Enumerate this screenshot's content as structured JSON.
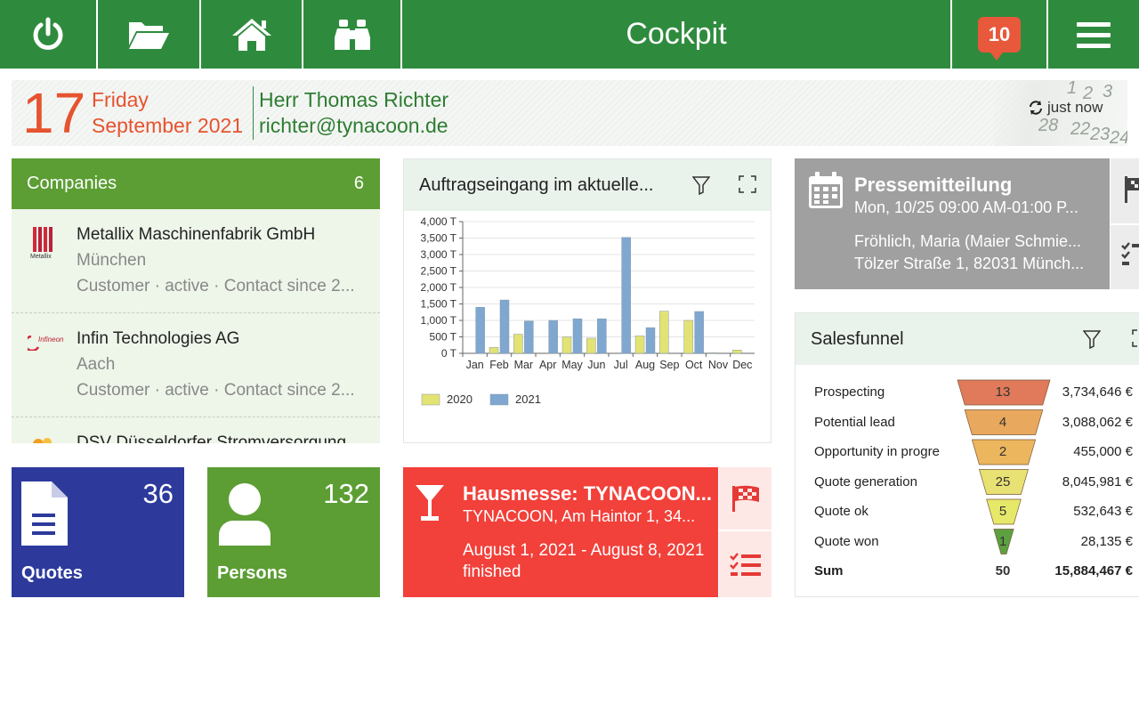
{
  "header": {
    "title": "Cockpit",
    "notification_count": "10"
  },
  "user": {
    "day": "17",
    "weekday": "Friday",
    "month_year": "September 2021",
    "name": "Herr Thomas Richter",
    "email": "richter@tynacoon.de",
    "refresh_text": "just now"
  },
  "companies": {
    "title": "Companies",
    "count": "6",
    "items": [
      {
        "name": "Metallix Maschinenfabrik GmbH",
        "city": "München",
        "meta": "Customer · active · Contact since 2...",
        "logo_text": "Metallix"
      },
      {
        "name": "Infin Technologies AG",
        "city": "Aach",
        "meta": "Customer · active · Contact since 2...",
        "logo_text": "Infineon"
      },
      {
        "name": "DSV Düsseldorfer Stromversorgung",
        "city": "",
        "meta": ""
      }
    ]
  },
  "quotes": {
    "label": "Quotes",
    "count": "36",
    "color": "#2d3a9c"
  },
  "persons": {
    "label": "Persons",
    "count": "132",
    "color": "#5c9e34"
  },
  "chart": {
    "title": "Auftragseingang im aktuelle..."
  },
  "chart_data": {
    "type": "bar",
    "title": "Auftragseingang im aktuelle...",
    "categories": [
      "Jan",
      "Feb",
      "Mar",
      "Apr",
      "May",
      "Jun",
      "Jul",
      "Aug",
      "Sep",
      "Oct",
      "Nov",
      "Dec"
    ],
    "series": [
      {
        "name": "2020",
        "color": "#e3e373",
        "values": [
          0,
          180,
          580,
          0,
          500,
          460,
          0,
          530,
          1280,
          1000,
          20,
          100
        ]
      },
      {
        "name": "2021",
        "color": "#7fa7d0",
        "values": [
          1400,
          1620,
          980,
          1000,
          1050,
          1050,
          3520,
          780,
          0,
          1270,
          0,
          0
        ]
      }
    ],
    "yticks": [
      "0 T",
      "500 T",
      "1,000 T",
      "1,500 T",
      "2,000 T",
      "2,500 T",
      "3,000 T",
      "3,500 T",
      "4,000 T"
    ],
    "ylim": [
      0,
      4000
    ],
    "legend_position": "bottom-left",
    "grid": true
  },
  "event": {
    "title": "Hausmesse: TYNACOON...",
    "subtitle": "TYNACOON, Am Haintor 1, 34...",
    "dates": "August 1, 2021 - August 8, 2021",
    "status": "finished",
    "color": "#f2403a"
  },
  "press": {
    "title": "Pressemitteilung",
    "datetime": "Mon, 10/25 09:00 AM-01:00 P...",
    "contact": "Fröhlich, Maria (Maier Schmie...",
    "address": "Tölzer Straße 1, 82031 Münch..."
  },
  "salesfunnel": {
    "title": "Salesfunnel",
    "rows": [
      {
        "label": "Prospecting",
        "count": "13",
        "value": "3,734,646 €",
        "color": "#e07a5a"
      },
      {
        "label": "Potential lead",
        "count": "4",
        "value": "3,088,062 €",
        "color": "#e8a85e"
      },
      {
        "label": "Opportunity in progre",
        "count": "2",
        "value": "455,000 €",
        "color": "#ecb65e"
      },
      {
        "label": "Quote generation",
        "count": "25",
        "value": "8,045,981 €",
        "color": "#e8e173"
      },
      {
        "label": "Quote ok",
        "count": "5",
        "value": "532,643 €",
        "color": "#e6e86a"
      },
      {
        "label": "Quote won",
        "count": "1",
        "value": "28,135 €",
        "color": "#5ca040"
      }
    ],
    "sum_label": "Sum",
    "sum_count": "50",
    "sum_value": "15,884,467 €"
  }
}
